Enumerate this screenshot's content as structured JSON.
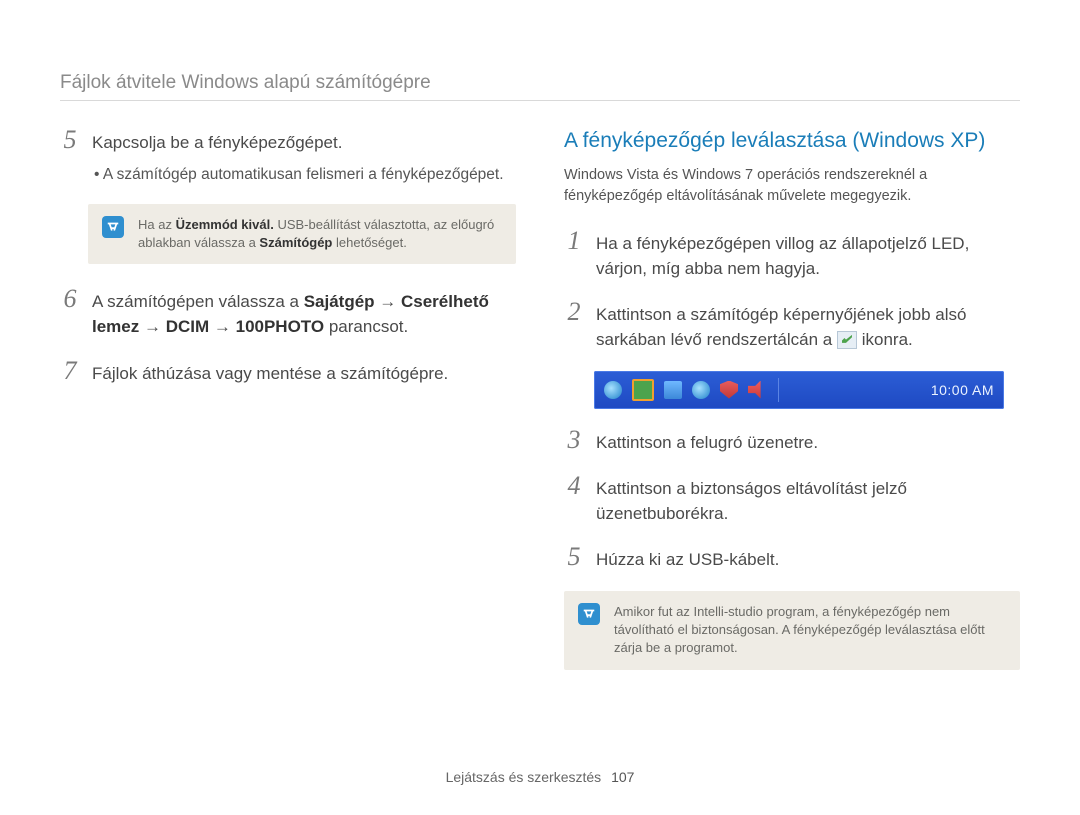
{
  "header": {
    "title": "Fájlok átvitele Windows alapú számítógépre"
  },
  "left": {
    "step5": {
      "num": "5",
      "text": "Kapcsolja be a fényképezőgépet.",
      "sub": "A számítógép automatikusan felismeri a fényképezőgépet."
    },
    "note": {
      "pre": "Ha az ",
      "b1": "Üzemmód kivál.",
      "mid": " USB-beállítást választotta, az előugró ablakban válassza a ",
      "b2": "Számítógép",
      "post": " lehetőséget."
    },
    "step6": {
      "num": "6",
      "pre": "A számítógépen válassza a ",
      "b1": "Sajátgép",
      "arrow1": " → ",
      "b2": "Cserélhető lemez",
      "arrow2": " → ",
      "b3": "DCIM",
      "arrow3": " → ",
      "b4": "100PHOTO",
      "post": " parancsot."
    },
    "step7": {
      "num": "7",
      "text": "Fájlok áthúzása vagy mentése a számítógépre."
    }
  },
  "right": {
    "heading": "A fényképezőgép leválasztása (Windows XP)",
    "intro": "Windows Vista és Windows 7 operációs rendszereknél a fényképezőgép eltávolításának művelete megegyezik.",
    "step1": {
      "num": "1",
      "text": "Ha a fényképezőgépen villog az állapotjelző LED, várjon, míg abba nem hagyja."
    },
    "step2": {
      "num": "2",
      "pre": "Kattintson a számítógép képernyőjének jobb alsó sarkában lévő rendszertálcán a ",
      "post": " ikonra."
    },
    "tray": {
      "clock": "10:00 AM"
    },
    "step3": {
      "num": "3",
      "text": "Kattintson a felugró üzenetre."
    },
    "step4": {
      "num": "4",
      "text": "Kattintson a biztonságos eltávolítást jelző üzenetbuborékra."
    },
    "step5": {
      "num": "5",
      "text": "Húzza ki az USB-kábelt."
    },
    "note": "Amikor fut az Intelli-studio program, a fényképezőgép nem távolítható el biztonságosan. A fényképezőgép leválasztása előtt zárja be a programot."
  },
  "footer": {
    "section": "Lejátszás és szerkesztés",
    "page": "107"
  }
}
